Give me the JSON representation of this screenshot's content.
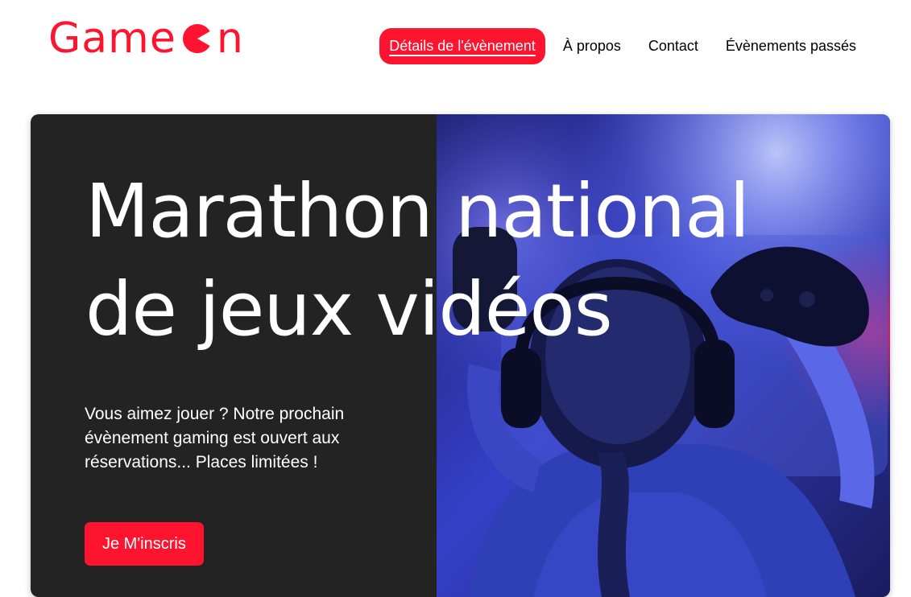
{
  "brand": {
    "prefix": "Game",
    "suffix": "n",
    "color": "#fe142f"
  },
  "nav": {
    "items": [
      {
        "label": "Détails de l'évènement",
        "active": true
      },
      {
        "label": "À propos"
      },
      {
        "label": "Contact"
      },
      {
        "label": "Évènements passés"
      }
    ]
  },
  "hero": {
    "title_line1": "Marathon national",
    "title_line2": "de jeux vidéos",
    "text": "Vous aimez jouer ? Notre prochain évènement gaming est ouvert aux réservations... Places limitées !",
    "cta_label": "Je M'inscris",
    "background": "#232323",
    "image_icon": "gamer-with-headphones-and-controller"
  }
}
